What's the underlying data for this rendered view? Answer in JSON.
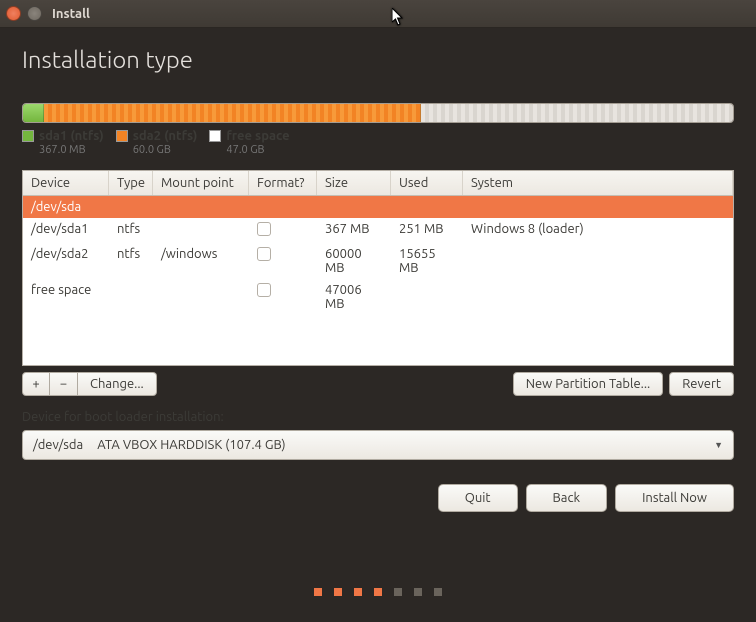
{
  "window": {
    "title": "Install"
  },
  "page": {
    "heading": "Installation type"
  },
  "disk_bar": {
    "segments": [
      {
        "label": "sda1 (ntfs)",
        "size": "367.0 MB",
        "color": "green",
        "pct": 3
      },
      {
        "label": "sda2 (ntfs)",
        "size": "60.0 GB",
        "color": "orange",
        "pct": 53
      },
      {
        "label": "free space",
        "size": "47.0 GB",
        "color": "white",
        "pct": 44
      }
    ]
  },
  "table": {
    "columns": [
      "Device",
      "Type",
      "Mount point",
      "Format?",
      "Size",
      "Used",
      "System"
    ],
    "rows": [
      {
        "device": "/dev/sda",
        "type": "",
        "mount": "",
        "format": null,
        "size": "",
        "used": "",
        "system": "",
        "is_header": true
      },
      {
        "device": "/dev/sda1",
        "type": "ntfs",
        "mount": "",
        "format": false,
        "size": "367 MB",
        "used": "251 MB",
        "system": "Windows 8 (loader)"
      },
      {
        "device": "/dev/sda2",
        "type": "ntfs",
        "mount": "/windows",
        "format": false,
        "size": "60000 MB",
        "used": "15655 MB",
        "system": ""
      },
      {
        "device": "free space",
        "type": "",
        "mount": "",
        "format": false,
        "size": "47006 MB",
        "used": "",
        "system": ""
      }
    ]
  },
  "toolbar": {
    "add": "+",
    "remove": "−",
    "change": "Change...",
    "new_table": "New Partition Table...",
    "revert": "Revert"
  },
  "boot": {
    "label": "Device for boot loader installation:",
    "device": "/dev/sda",
    "desc": "ATA VBOX HARDDISK (107.4 GB)"
  },
  "actions": {
    "quit": "Quit",
    "back": "Back",
    "install": "Install Now"
  },
  "pager": {
    "total": 7,
    "active": [
      0,
      1,
      2,
      3
    ]
  }
}
